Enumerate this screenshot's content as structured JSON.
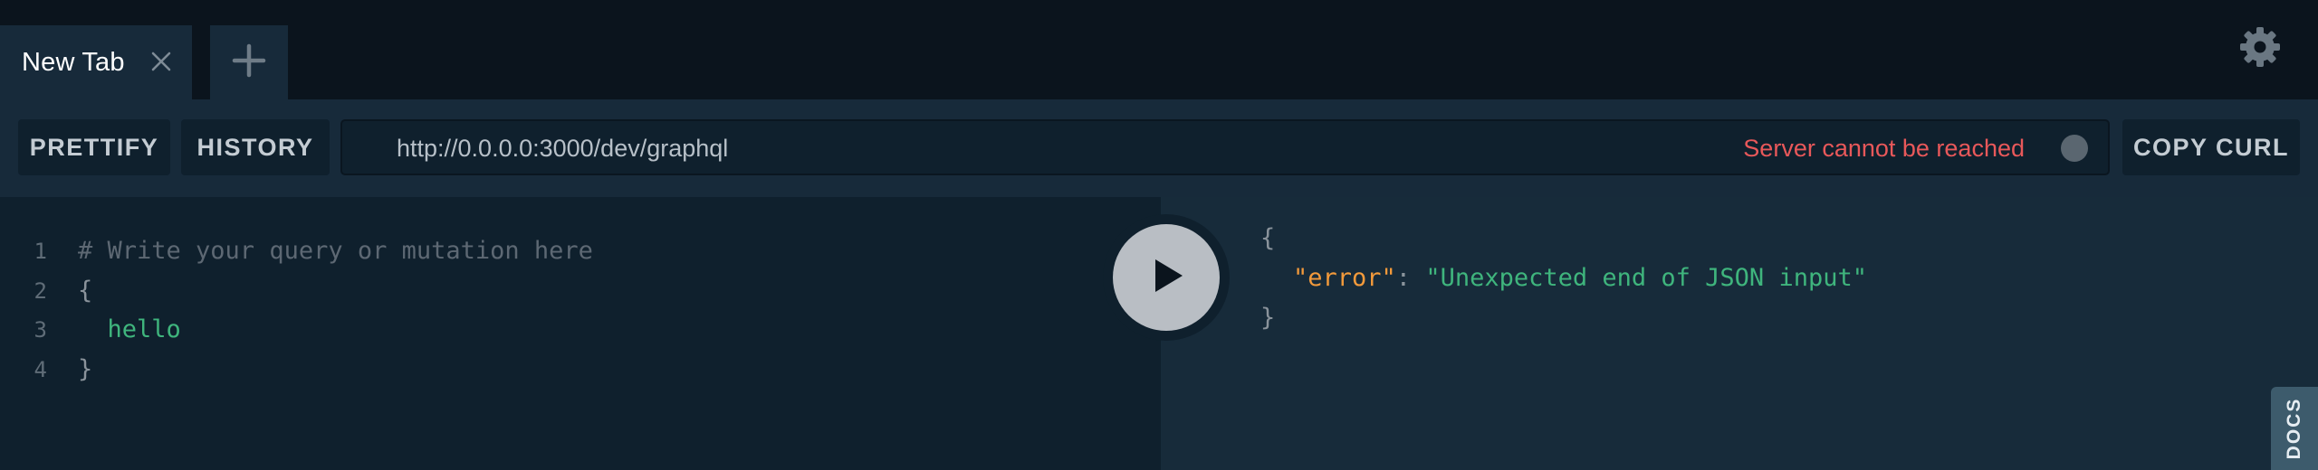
{
  "tabs": [
    {
      "label": "New Tab"
    }
  ],
  "toolbar": {
    "prettify_label": "PRETTIFY",
    "history_label": "HISTORY",
    "copy_curl_label": "COPY CURL",
    "endpoint_url": "http://0.0.0.0:3000/dev/graphql",
    "server_status": "Server cannot be reached"
  },
  "editor": {
    "lines": [
      {
        "number": "1",
        "text": "# Write your query or mutation here"
      },
      {
        "number": "2",
        "text": "{"
      },
      {
        "number": "3",
        "text": "  hello"
      },
      {
        "number": "4",
        "text": "}"
      }
    ]
  },
  "result": {
    "open_brace": "{",
    "key": "\"error\"",
    "colon": ": ",
    "value": "\"Unexpected end of JSON input\"",
    "close_brace": "}"
  },
  "docs_label": "DOCS",
  "icons": {
    "tab_close": "close-icon",
    "add_tab": "plus-icon",
    "settings": "gear-icon",
    "execute": "play-icon"
  },
  "colors": {
    "error_status": "#e8585a",
    "field": "#3fb57d",
    "json_key": "#f39a3b",
    "background": "#172b3a",
    "editor_background": "#0f202d"
  }
}
